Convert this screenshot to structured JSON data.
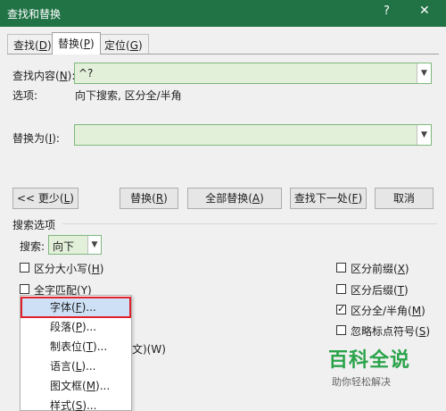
{
  "window": {
    "title": "查找和替换",
    "help": "?",
    "close": "✕"
  },
  "tabs": [
    {
      "label_pre": "查找(",
      "key": "D",
      "label_post": ")"
    },
    {
      "label_pre": "替换(",
      "key": "P",
      "label_post": ")"
    },
    {
      "label_pre": "定位(",
      "key": "G",
      "label_post": ")"
    }
  ],
  "find": {
    "label_pre": "查找内容(",
    "key": "N",
    "label_post": "):",
    "value": "^?"
  },
  "options": {
    "label": "选项:",
    "value": "向下搜索, 区分全/半角"
  },
  "replace": {
    "label_pre": "替换为(",
    "key": "I",
    "label_post": "):",
    "value": ""
  },
  "buttons": {
    "less": {
      "pre": "<< 更少(",
      "key": "L",
      "post": ")"
    },
    "replace": {
      "pre": "替换(",
      "key": "R",
      "post": ")"
    },
    "replace_all": {
      "pre": "全部替换(",
      "key": "A",
      "post": ")"
    },
    "find_next": {
      "pre": "查找下一处(",
      "key": "F",
      "post": ")"
    },
    "cancel": "取消"
  },
  "search_options": {
    "heading": "搜索选项",
    "search_label": "搜索:",
    "search_value": "向下",
    "match_case": {
      "pre": "区分大小写(",
      "key": "H",
      "post": ")",
      "checked": false
    },
    "whole_word": {
      "pre": "全字匹配(",
      "key": "Y",
      "post": ")",
      "checked": false
    },
    "prefix": {
      "pre": "区分前缀(",
      "key": "X",
      "post": ")",
      "checked": false
    },
    "suffix": {
      "pre": "区分后缀(",
      "key": "T",
      "post": ")",
      "checked": false
    },
    "width": {
      "pre": "区分全/半角(",
      "key": "M",
      "post": ")",
      "checked": true
    },
    "punct": {
      "pre": "忽略标点符号(",
      "key": "S",
      "post": ")",
      "checked": false
    },
    "partial_label": "文)(W)"
  },
  "format_menu": {
    "items": [
      {
        "pre": "字体(",
        "key": "F",
        "post": ")..."
      },
      {
        "pre": "段落(",
        "key": "P",
        "post": ")..."
      },
      {
        "pre": "制表位(",
        "key": "T",
        "post": ")..."
      },
      {
        "pre": "语言(",
        "key": "L",
        "post": ")..."
      },
      {
        "pre": "图文框(",
        "key": "M",
        "post": ")..."
      },
      {
        "pre": "样式(",
        "key": "S",
        "post": ")..."
      }
    ]
  },
  "watermark": {
    "title": "百科全说",
    "subtitle": "助你轻松解决"
  },
  "colors": {
    "titlebar": "#217346",
    "field_bg": "#e2f0d9",
    "highlight_border": "#e0202a",
    "watermark": "#2aa34a"
  }
}
